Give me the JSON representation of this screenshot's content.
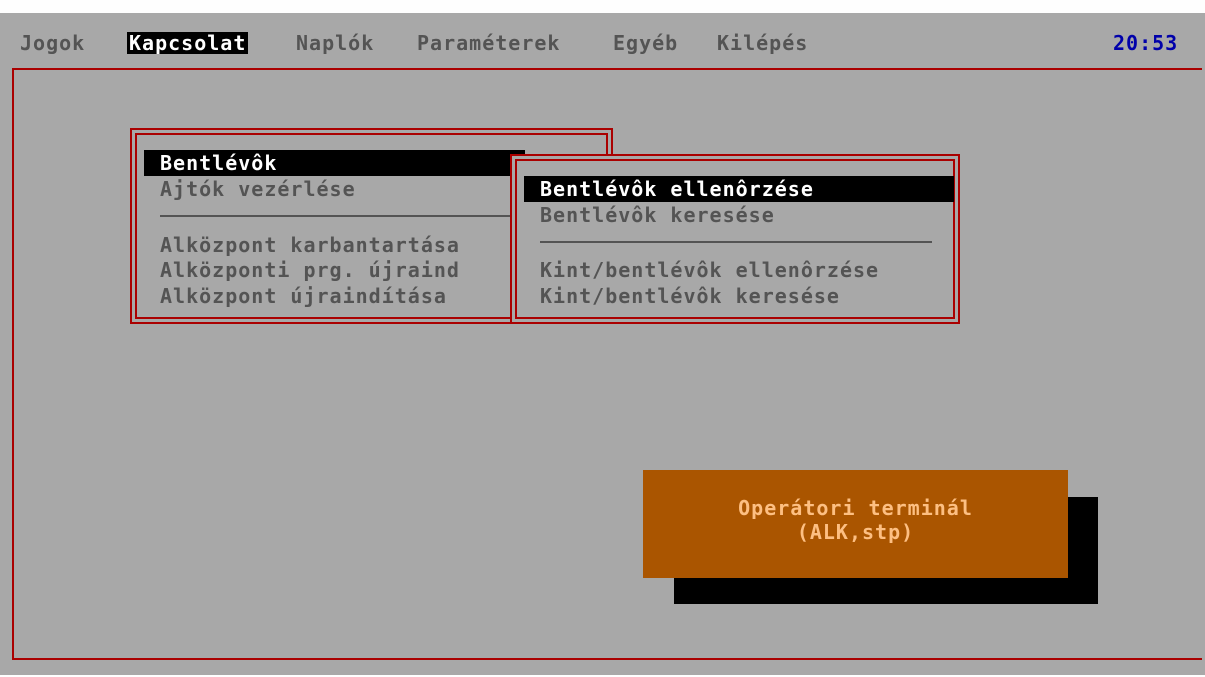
{
  "menubar": {
    "items": [
      {
        "label": "Jogok"
      },
      {
        "label": "Kapcsolat"
      },
      {
        "label": "Naplók"
      },
      {
        "label": "Paraméterek"
      },
      {
        "label": "Egyéb"
      },
      {
        "label": "Kilépés"
      }
    ],
    "active_item": "Kapcsolat",
    "clock": "20:53"
  },
  "kapcsolat_menu": {
    "items": [
      {
        "label": "Bentlévôk",
        "selected": true
      },
      {
        "label": "Ajtók vezérlése"
      },
      {
        "label": "Alközpont karbantartása"
      },
      {
        "label": "Alközponti prg. újraind"
      },
      {
        "label": "Alközpont újraindítása"
      }
    ]
  },
  "bentlevok_submenu": {
    "items": [
      {
        "label": "Bentlévôk ellenôrzése",
        "selected": true
      },
      {
        "label": "Bentlévôk keresése"
      },
      {
        "label": "Kint/bentlévôk ellenôrzése"
      },
      {
        "label": "Kint/bentlévôk keresése"
      }
    ]
  },
  "terminal": {
    "line1": "Operátori terminál",
    "line2": "(ALK,stp)"
  },
  "colors": {
    "background": "#a8a8a8",
    "border": "#aa0000",
    "text": "#545454",
    "clock": "#0000aa",
    "terminal_bg": "#aa5500",
    "terminal_text": "#fdbf82"
  }
}
